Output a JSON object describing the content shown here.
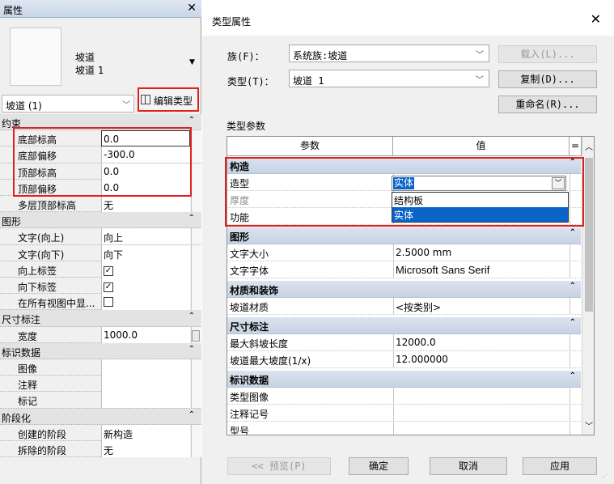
{
  "palette": {
    "title": "属性",
    "close_glyph": "✕",
    "type_family": "坡道",
    "type_name": "坡道 1",
    "instance_selector": "坡道 (1)",
    "edit_type_label": "编辑类型",
    "groups": [
      {
        "label": "约束",
        "rows": [
          {
            "name": "底部标高",
            "value": "0.0"
          },
          {
            "name": "底部偏移",
            "value": "-300.0"
          },
          {
            "name": "顶部标高",
            "value": "0.0"
          },
          {
            "name": "顶部偏移",
            "value": "0.0"
          },
          {
            "name": "多层顶部标高",
            "value": "无"
          }
        ]
      },
      {
        "label": "图形",
        "rows": [
          {
            "name": "文字(向上)",
            "value": "向上"
          },
          {
            "name": "文字(向下)",
            "value": "向下"
          },
          {
            "name": "向上标签",
            "value": "",
            "checked": true
          },
          {
            "name": "向下标签",
            "value": "",
            "checked": true
          },
          {
            "name": "在所有视图中显...",
            "value": "",
            "checked": false
          }
        ]
      },
      {
        "label": "尺寸标注",
        "rows": [
          {
            "name": "宽度",
            "value": "1000.0"
          }
        ]
      },
      {
        "label": "标识数据",
        "rows": [
          {
            "name": "图像",
            "value": ""
          },
          {
            "name": "注释",
            "value": ""
          },
          {
            "name": "标记",
            "value": ""
          }
        ]
      },
      {
        "label": "阶段化",
        "rows": [
          {
            "name": "创建的阶段",
            "value": "新构造"
          },
          {
            "name": "拆除的阶段",
            "value": "无"
          }
        ]
      }
    ]
  },
  "dialog": {
    "title": "类型属性",
    "close_glyph": "✕",
    "family_label": "族(F)：",
    "family_value": "系统族:坡道",
    "type_label": "类型(T)：",
    "type_value": "坡道 1",
    "load_button": "载入(L)...",
    "duplicate_button": "复制(D)...",
    "rename_button": "重命名(R)...",
    "type_params_label": "类型参数",
    "col_param": "参数",
    "col_value": "值",
    "col_eq": "=",
    "groups": [
      {
        "label": "构造",
        "rows": [
          {
            "name": "造型",
            "value": ""
          },
          {
            "name": "厚度",
            "value": ""
          },
          {
            "name": "功能",
            "value": ""
          }
        ]
      },
      {
        "label": "图形",
        "rows": [
          {
            "name": "文字大小",
            "value": "2.5000 mm"
          },
          {
            "name": "文字字体",
            "value": "Microsoft Sans Serif"
          }
        ]
      },
      {
        "label": "材质和装饰",
        "rows": [
          {
            "name": "坡道材质",
            "value": "<按类别>"
          }
        ]
      },
      {
        "label": "尺寸标注",
        "rows": [
          {
            "name": "最大斜坡长度",
            "value": "12000.0"
          },
          {
            "name": "坡道最大坡度(1/x)",
            "value": "12.000000"
          }
        ]
      },
      {
        "label": "标识数据",
        "rows": [
          {
            "name": "类型图像",
            "value": ""
          },
          {
            "name": "注释记号",
            "value": ""
          },
          {
            "name": "型号",
            "value": ""
          }
        ]
      }
    ],
    "shape_selected": "实体",
    "shape_options": [
      "结构板",
      "实体"
    ],
    "shape_highlighted_option": "实体",
    "preview_button": "<< 预览(P)",
    "ok_button": "确定",
    "cancel_button": "取消",
    "apply_button": "应用"
  }
}
